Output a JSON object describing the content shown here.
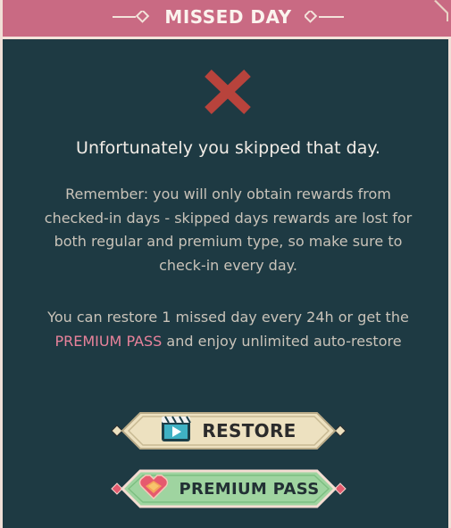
{
  "dialog": {
    "title": "MISSED DAY",
    "headline": "Unfortunately you skipped that day.",
    "info_paragraph": "Remember: you will only obtain rewards from checked-in days - skipped days rewards are lost for both regular and premium type, so make sure to check-in every day.",
    "restore_text_before": "You can restore 1 missed day every 24h or get the ",
    "restore_text_highlight": "PREMIUM PASS",
    "restore_text_after": " and enjoy unlimited auto-restore"
  },
  "buttons": {
    "restore_label": "RESTORE",
    "premium_label": "PREMIUM PASS"
  },
  "icons": {
    "status": "cross-icon",
    "restore": "video-play-icon",
    "premium": "heart-gem-icon",
    "title_decoration": "diamond-line-ornament"
  },
  "colors": {
    "panel_bg": "#1e3a43",
    "header_bg": "#c96a83",
    "cross": "#b8433c",
    "highlight": "#e8829b",
    "restore_button": "#ede1c0",
    "premium_button": "#9fd4a0"
  }
}
